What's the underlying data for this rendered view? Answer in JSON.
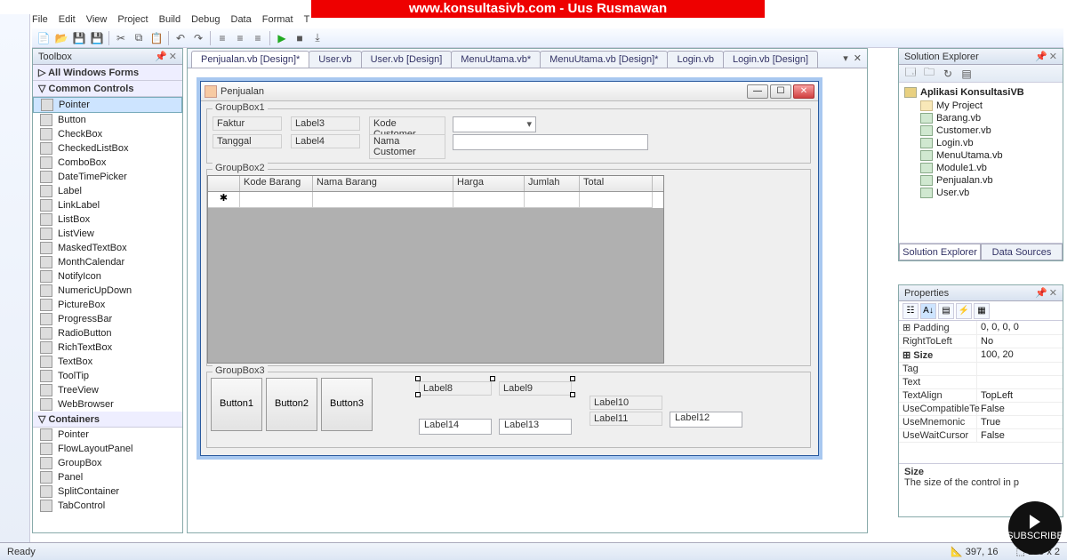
{
  "banner": "www.konsultasivb.com - Uus Rusmawan",
  "menus": [
    "File",
    "Edit",
    "View",
    "Project",
    "Build",
    "Debug",
    "Data",
    "Format",
    "T"
  ],
  "toolbox": {
    "title": "Toolbox",
    "groups": [
      "All Windows Forms",
      "Common Controls"
    ],
    "items": [
      "Pointer",
      "Button",
      "CheckBox",
      "CheckedListBox",
      "ComboBox",
      "DateTimePicker",
      "Label",
      "LinkLabel",
      "ListBox",
      "ListView",
      "MaskedTextBox",
      "MonthCalendar",
      "NotifyIcon",
      "NumericUpDown",
      "PictureBox",
      "ProgressBar",
      "RadioButton",
      "RichTextBox",
      "TextBox",
      "ToolTip",
      "TreeView",
      "WebBrowser"
    ],
    "group3": "Containers",
    "items2": [
      "Pointer",
      "FlowLayoutPanel",
      "GroupBox",
      "Panel",
      "SplitContainer",
      "TabControl"
    ]
  },
  "tabs": [
    {
      "label": "Penjualan.vb [Design]*",
      "active": true
    },
    {
      "label": "User.vb"
    },
    {
      "label": "User.vb [Design]"
    },
    {
      "label": "MenuUtama.vb*"
    },
    {
      "label": "MenuUtama.vb [Design]*"
    },
    {
      "label": "Login.vb"
    },
    {
      "label": "Login.vb [Design]"
    }
  ],
  "form": {
    "title": "Penjualan",
    "gb1": "GroupBox1",
    "gb2": "GroupBox2",
    "gb3": "GroupBox3",
    "l_faktur": "Faktur",
    "l_tanggal": "Tanggal",
    "l_label3": "Label3",
    "l_label4": "Label4",
    "l_kodecust": "Kode Customer",
    "l_namacust": "Nama Customer",
    "grid_cols": [
      "",
      "Kode Barang",
      "Nama Barang",
      "Harga",
      "Jumlah",
      "Total"
    ],
    "btn1": "Button1",
    "btn2": "Button2",
    "btn3": "Button3",
    "l8": "Label8",
    "l9": "Label9",
    "l10": "Label10",
    "l11": "Label11",
    "l12": "Label12",
    "l13": "Label13",
    "l14": "Label14"
  },
  "solution": {
    "title": "Solution Explorer",
    "project": "Aplikasi KonsultasiVB",
    "items": [
      "My Project",
      "Barang.vb",
      "Customer.vb",
      "Login.vb",
      "MenuUtama.vb",
      "Module1.vb",
      "Penjualan.vb",
      "User.vb"
    ],
    "tabs": [
      "Solution Explorer",
      "Data Sources"
    ]
  },
  "properties": {
    "title": "Properties",
    "rows": [
      {
        "n": "Padding",
        "v": "0, 0, 0, 0",
        "exp": true
      },
      {
        "n": "RightToLeft",
        "v": "No"
      },
      {
        "n": "Size",
        "v": "100, 20",
        "exp": true,
        "hl": true
      },
      {
        "n": "Tag",
        "v": ""
      },
      {
        "n": "Text",
        "v": ""
      },
      {
        "n": "TextAlign",
        "v": "TopLeft"
      },
      {
        "n": "UseCompatibleTe",
        "v": "False"
      },
      {
        "n": "UseMnemonic",
        "v": "True"
      },
      {
        "n": "UseWaitCursor",
        "v": "False"
      }
    ],
    "desc_name": "Size",
    "desc_text": "The size of the control in p"
  },
  "status": {
    "ready": "Ready",
    "pos": "397, 16",
    "size": "100 x 2"
  },
  "subscribe": "SUBSCRIBE"
}
